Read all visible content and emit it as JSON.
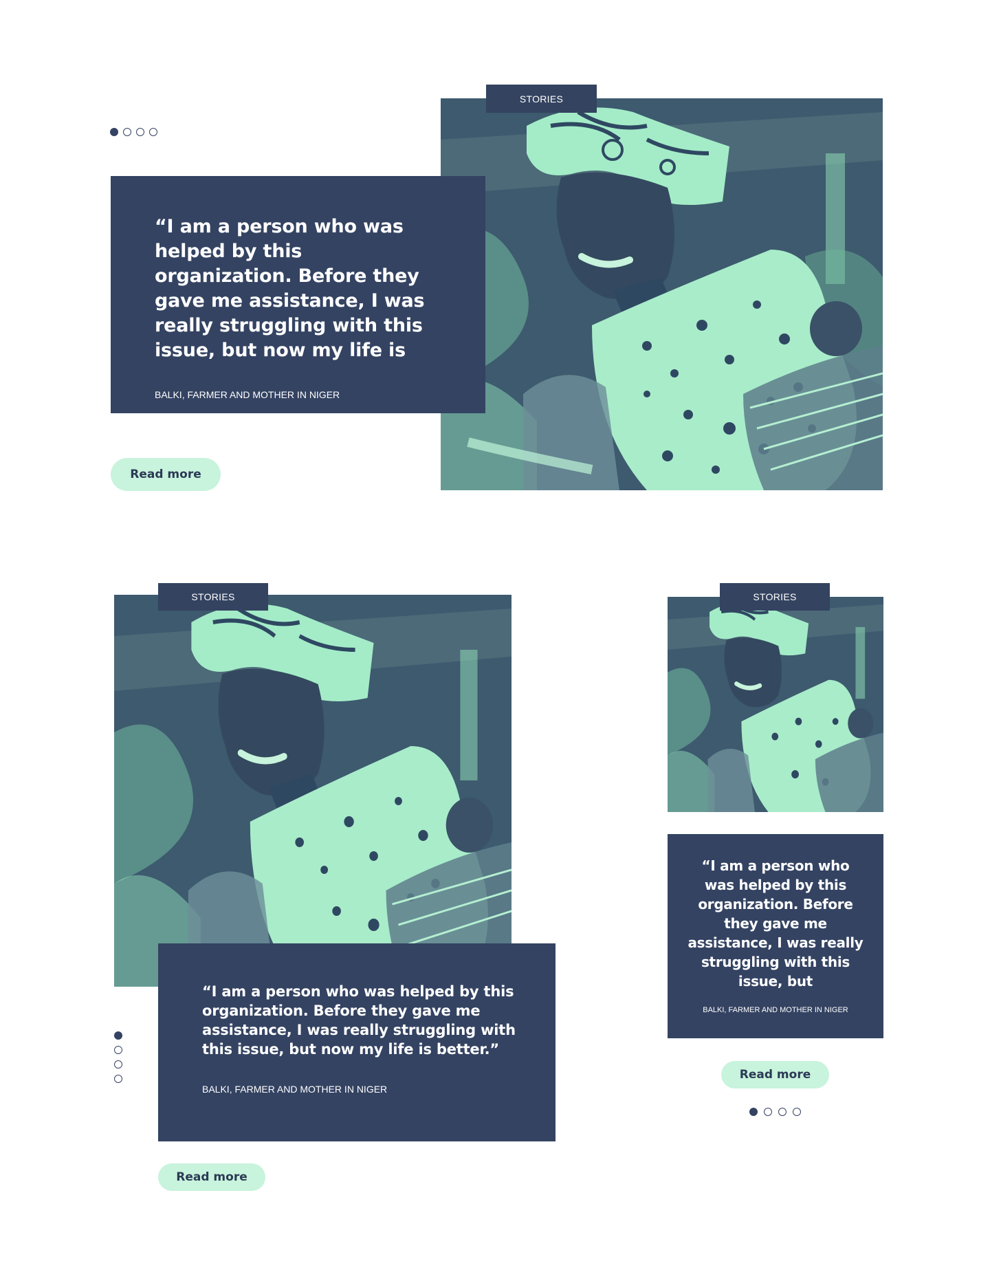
{
  "colors": {
    "navy": "#344362",
    "mint": "#c8f3dc",
    "photo_light": "#9be8c4",
    "photo_dark": "#2f4862"
  },
  "slides_count": 4,
  "active_index": 0,
  "desktop": {
    "tag": "STORIES",
    "quote": "“I am a person who was helped by this organization. Before they gave me assistance, I was really struggling with this issue, but now my life is",
    "attribution": "BALKI, FARMER AND MOTHER IN NIGER",
    "button": "Read more",
    "photo_icon": "portrait-photo-icon"
  },
  "tablet": {
    "tag": "STORIES",
    "quote": "“I am a person who was helped by this organization. Before they gave me assistance, I was really struggling with this issue, but now my life is better.”",
    "attribution": "BALKI, FARMER AND MOTHER IN NIGER",
    "button": "Read more",
    "photo_icon": "portrait-photo-icon"
  },
  "mobile": {
    "tag": "STORIES",
    "quote": "“I am a person who was helped by this organization. Before they gave me assistance, I was really struggling with this issue, but",
    "attribution": "BALKI, FARMER AND MOTHER IN NIGER",
    "button": "Read more",
    "photo_icon": "portrait-photo-icon"
  }
}
